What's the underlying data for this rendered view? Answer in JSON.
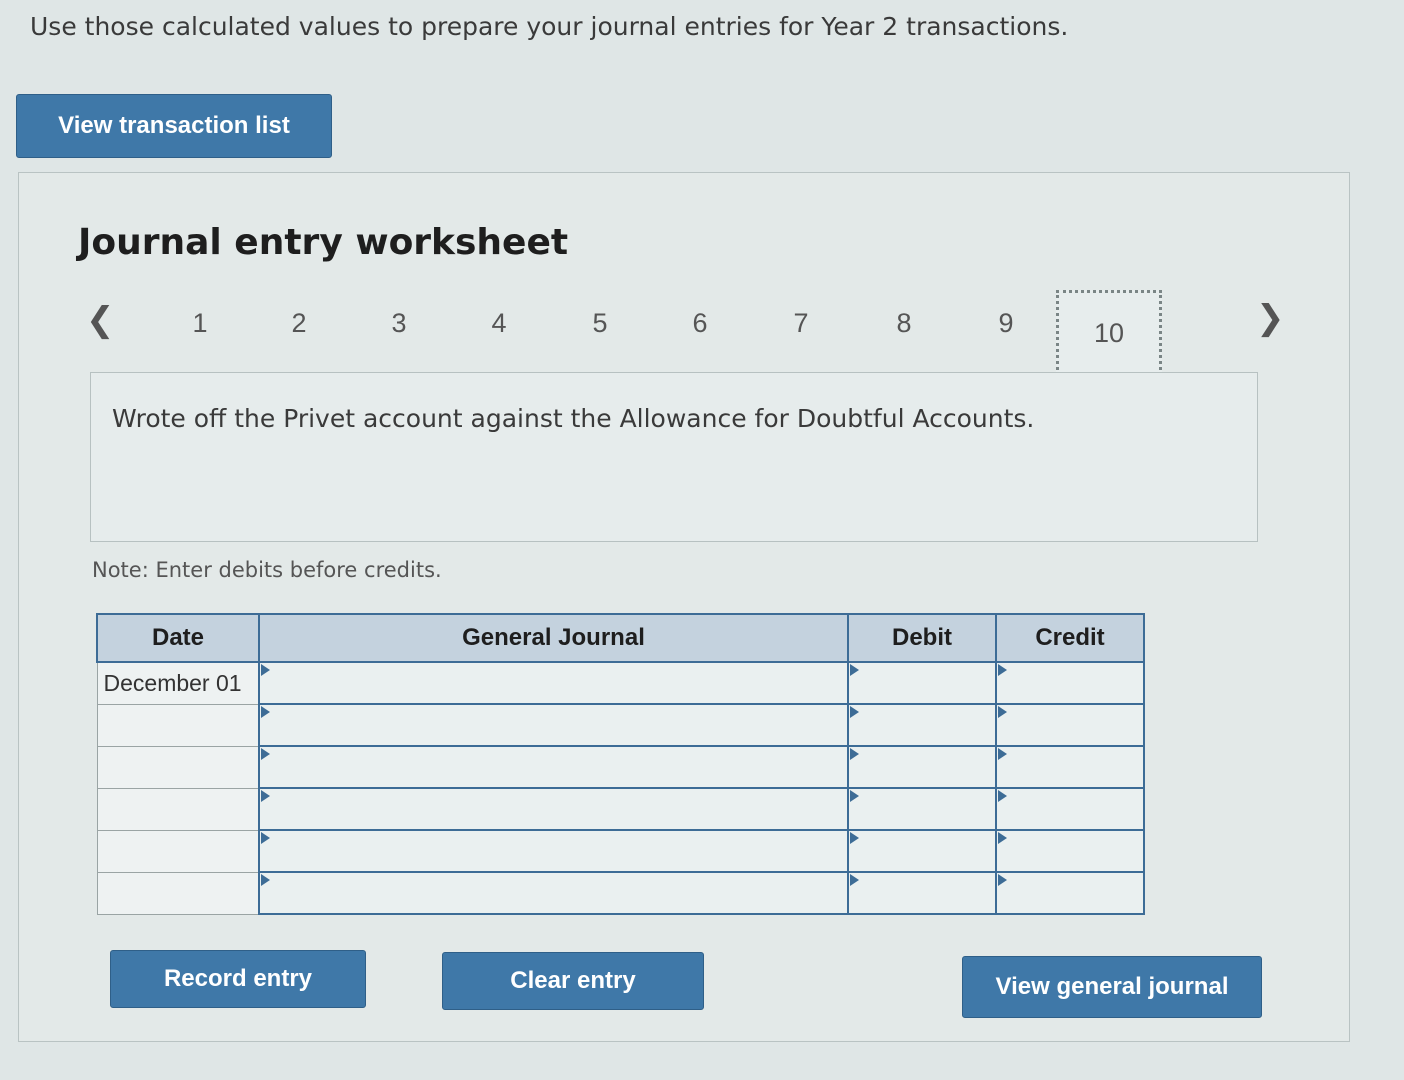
{
  "instruction": "Use those calculated values to prepare your journal entries for Year 2 transactions.",
  "buttons": {
    "view_transaction_list": "View transaction list",
    "record_entry": "Record entry",
    "clear_entry": "Clear entry",
    "view_general_journal": "View general journal"
  },
  "worksheet": {
    "title": "Journal entry worksheet",
    "pages": [
      "1",
      "2",
      "3",
      "4",
      "5",
      "6",
      "7",
      "8",
      "9",
      "10"
    ],
    "active_page": "10",
    "prev_icon": "chevron-left-icon",
    "next_icon": "chevron-right-icon",
    "description": "Wrote off the Privet account against the Allowance for Doubtful Accounts.",
    "note": "Note: Enter debits before credits."
  },
  "journal": {
    "headers": [
      "Date",
      "General Journal",
      "Debit",
      "Credit"
    ],
    "rows": [
      {
        "date": "December 01",
        "account": "",
        "debit": "",
        "credit": ""
      },
      {
        "date": "",
        "account": "",
        "debit": "",
        "credit": ""
      },
      {
        "date": "",
        "account": "",
        "debit": "",
        "credit": ""
      },
      {
        "date": "",
        "account": "",
        "debit": "",
        "credit": ""
      },
      {
        "date": "",
        "account": "",
        "debit": "",
        "credit": ""
      },
      {
        "date": "",
        "account": "",
        "debit": "",
        "credit": ""
      }
    ]
  },
  "colors": {
    "button_blue": "#3f78a8",
    "table_border": "#3d6c96",
    "header_bg": "#c4d2de"
  }
}
